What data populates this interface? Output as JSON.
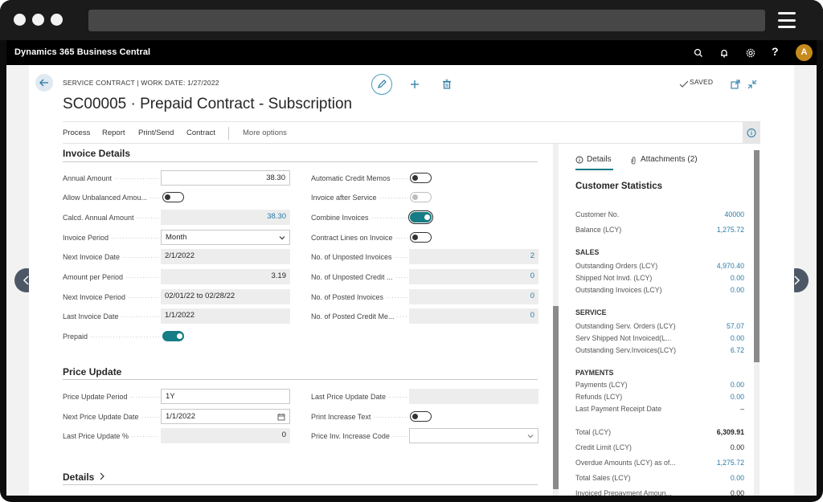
{
  "app": {
    "title": "Dynamics 365 Business Central",
    "avatar_initial": "A",
    "help_label": "?"
  },
  "page": {
    "breadcrumb": "SERVICE CONTRACT | WORK DATE: 1/27/2022",
    "title": "SC00005 · Prepaid Contract - Subscription",
    "saved_label": "SAVED"
  },
  "menu": {
    "items": [
      "Process",
      "Report",
      "Print/Send",
      "Contract"
    ],
    "more": "More options"
  },
  "invoice_details": {
    "title": "Invoice Details",
    "left": {
      "annual_amount": {
        "label": "Annual Amount",
        "value": "38.30"
      },
      "allow_unbalanced": {
        "label": "Allow Unbalanced Amou...",
        "on": false
      },
      "calcd_annual_amount": {
        "label": "Calcd. Annual Amount",
        "value": "38.30"
      },
      "invoice_period": {
        "label": "Invoice Period",
        "value": "Month"
      },
      "next_invoice_date": {
        "label": "Next Invoice Date",
        "value": "2/1/2022"
      },
      "amount_per_period": {
        "label": "Amount per Period",
        "value": "3.19"
      },
      "next_invoice_period": {
        "label": "Next Invoice Period",
        "value": "02/01/22 to 02/28/22"
      },
      "last_invoice_date": {
        "label": "Last Invoice Date",
        "value": "1/1/2022"
      },
      "prepaid": {
        "label": "Prepaid",
        "on": true
      }
    },
    "right": {
      "automatic_credit_memos": {
        "label": "Automatic Credit Memos",
        "on": false
      },
      "invoice_after_service": {
        "label": "Invoice after Service",
        "on": false
      },
      "combine_invoices": {
        "label": "Combine Invoices",
        "on": true
      },
      "contract_lines_on_invoice": {
        "label": "Contract Lines on Invoice",
        "on": false
      },
      "unposted_invoices": {
        "label": "No. of Unposted Invoices",
        "value": "2"
      },
      "unposted_credit": {
        "label": "No. of Unposted Credit ...",
        "value": "0"
      },
      "posted_invoices": {
        "label": "No. of Posted Invoices",
        "value": "0"
      },
      "posted_credit": {
        "label": "No. of Posted Credit Me...",
        "value": "0"
      }
    }
  },
  "price_update": {
    "title": "Price Update",
    "price_update_period": {
      "label": "Price Update Period",
      "value": "1Y"
    },
    "next_price_update_date": {
      "label": "Next Price Update Date",
      "value": "1/1/2022"
    },
    "last_price_update_pct": {
      "label": "Last Price Update %",
      "value": "0"
    },
    "last_price_update_date": {
      "label": "Last Price Update Date",
      "value": ""
    },
    "print_increase_text": {
      "label": "Print Increase Text",
      "on": false
    },
    "price_inv_increase_code": {
      "label": "Price Inv. Increase Code",
      "value": ""
    }
  },
  "details_section": {
    "title": "Details"
  },
  "factbox": {
    "tabs": {
      "details": "Details",
      "attachments": "Attachments (2)"
    },
    "title": "Customer Statistics",
    "rows_top": [
      {
        "label": "Customer No.",
        "value": "40000"
      },
      {
        "label": "Balance (LCY)",
        "value": "1,275.72"
      }
    ],
    "sales": {
      "title": "SALES",
      "rows": [
        {
          "label": "Outstanding Orders (LCY)",
          "value": "4,970.40"
        },
        {
          "label": "Shipped Not Invd. (LCY)",
          "value": "0.00"
        },
        {
          "label": "Outstanding Invoices (LCY)",
          "value": "0.00"
        }
      ]
    },
    "service": {
      "title": "SERVICE",
      "rows": [
        {
          "label": "Outstanding Serv. Orders (LCY)",
          "value": "57.07"
        },
        {
          "label": "Serv Shipped Not Invoiced(L...",
          "value": "0.00"
        },
        {
          "label": "Outstanding Serv.Invoices(LCY)",
          "value": "6.72"
        }
      ]
    },
    "payments": {
      "title": "PAYMENTS",
      "rows": [
        {
          "label": "Payments (LCY)",
          "value": "0.00"
        },
        {
          "label": "Refunds (LCY)",
          "value": "0.00"
        },
        {
          "label": "Last Payment Receipt Date",
          "value": "–"
        }
      ]
    },
    "totals": [
      {
        "label": "Total (LCY)",
        "value": "6,309.91"
      },
      {
        "label": "Credit Limit (LCY)",
        "value": "0.00"
      },
      {
        "label": "Overdue Amounts (LCY) as of...",
        "value": "1,275.72"
      },
      {
        "label": "Total Sales (LCY)",
        "value": "0.00"
      },
      {
        "label": "Invoiced Prepayment Amoun...",
        "value": "0.00"
      }
    ]
  },
  "colors": {
    "accent": "#167c85",
    "link": "#2a7aa6",
    "appbar": "#000000",
    "avatar": "#c78b1d"
  }
}
